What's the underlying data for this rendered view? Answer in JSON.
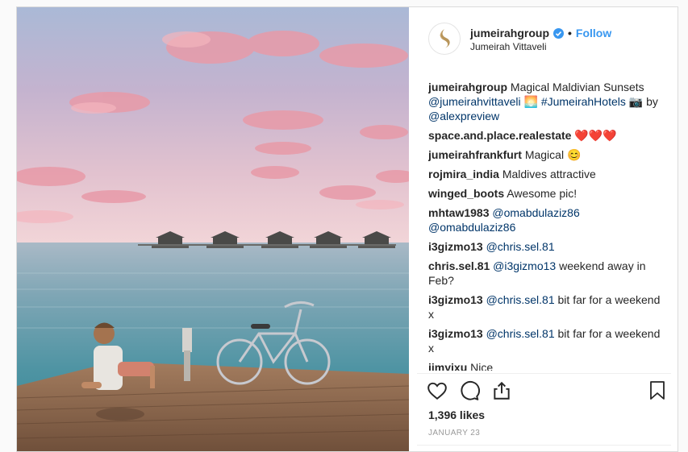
{
  "header": {
    "username": "jumeirahgroup",
    "follow_label": "Follow",
    "location": "Jumeirah Vittaveli"
  },
  "caption": {
    "username": "jumeirahgroup",
    "text": "Magical Maldivian Sunsets",
    "mention": "@jumeirahvittaveli",
    "emoji": "🌅",
    "hashtag": "#JumeirahHotels",
    "camera_emoji": "📷",
    "by_text": "by",
    "credit": "@alexpreview"
  },
  "comments": [
    {
      "username": "space.and.place.realestate",
      "mention": "",
      "text": "❤️❤️❤️"
    },
    {
      "username": "jumeirahfrankfurt",
      "mention": "",
      "text": "Magical 😊"
    },
    {
      "username": "rojmira_india",
      "mention": "",
      "text": "Maldives attractive"
    },
    {
      "username": "winged_boots",
      "mention": "",
      "text": "Awesome pic!"
    },
    {
      "username": "mhtaw1983",
      "mention": "@omabdulaziz86 @omabdulaziz86",
      "text": ""
    },
    {
      "username": "i3gizmo13",
      "mention": "@chris.sel.81",
      "text": ""
    },
    {
      "username": "chris.sel.81",
      "mention": "@i3gizmo13",
      "text": "weekend away in Feb?"
    },
    {
      "username": "i3gizmo13",
      "mention": "@chris.sel.81",
      "text": "bit far for a weekend x"
    },
    {
      "username": "i3gizmo13",
      "mention": "@chris.sel.81",
      "text": "bit far for a weekend x"
    },
    {
      "username": "jimyixu",
      "mention": "",
      "text": "Nice"
    }
  ],
  "icons": {
    "like": "heart-icon",
    "comment": "comment-icon",
    "share": "share-icon",
    "save": "bookmark-icon",
    "verified": "verified-badge-icon",
    "avatar": "jumeirah-logo-icon"
  },
  "likes": "1,396 likes",
  "date": "JANUARY 23",
  "colors": {
    "link": "#3897f0",
    "mention": "#003569",
    "verified": "#3897f0",
    "heart_emoji": "#e0245e",
    "avatar_gold": "#b8955a"
  }
}
